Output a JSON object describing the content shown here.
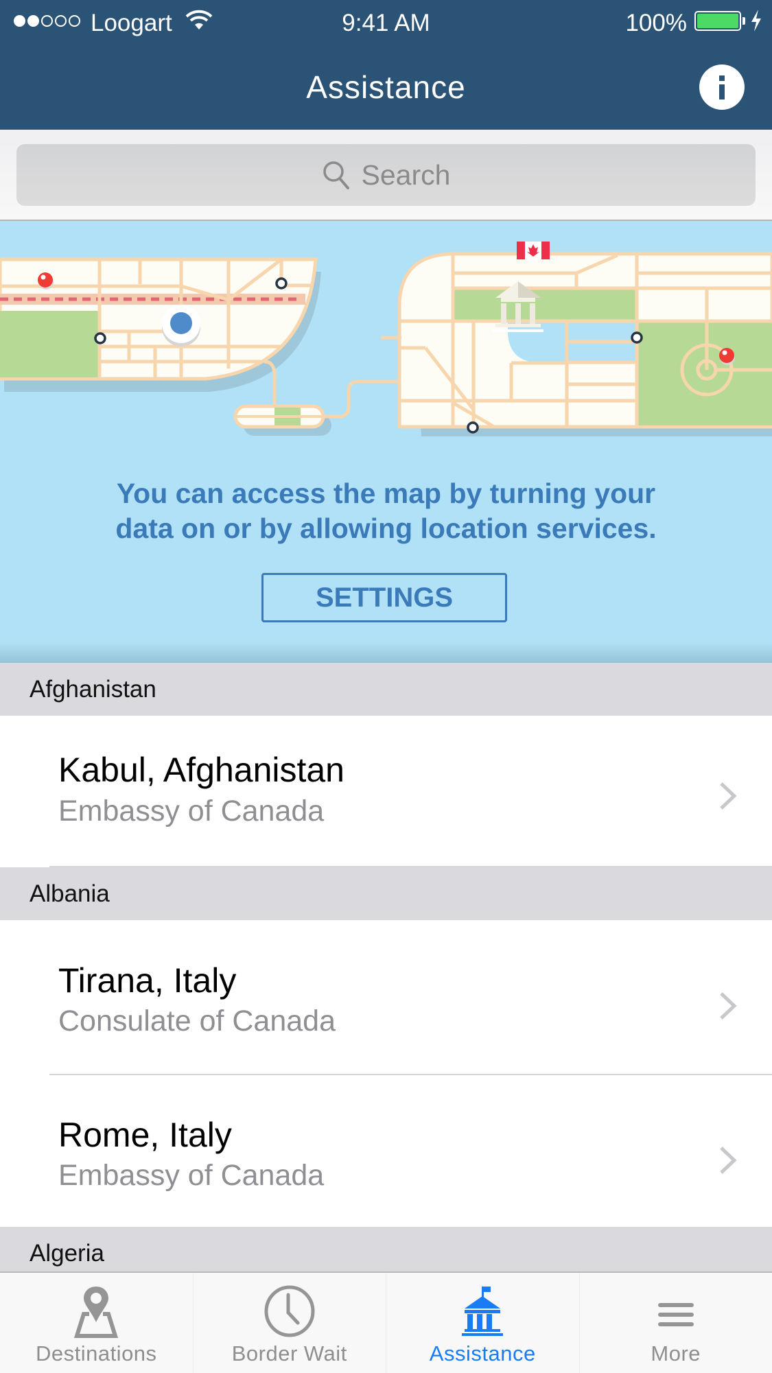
{
  "status_bar": {
    "signal_filled": 2,
    "signal_total": 5,
    "carrier": "Loogart",
    "time": "9:41 AM",
    "battery_percent": "100%",
    "battery_level": 1.0,
    "charging": true
  },
  "header": {
    "title": "Assistance",
    "info_icon": "info-icon"
  },
  "search": {
    "placeholder": "Search",
    "icon": "search-icon"
  },
  "map_banner": {
    "message": "You can access the map by turning your data on or by allowing  location services.",
    "message_line1": "You can access the map by turning your",
    "message_line2": "data on or by allowing  location services.",
    "button_label": "SETTINGS"
  },
  "sections": [
    {
      "title": "Afghanistan",
      "items": [
        {
          "city": "Kabul, Afghanistan",
          "office": "Embassy of Canada"
        }
      ]
    },
    {
      "title": "Albania",
      "items": [
        {
          "city": "Tirana, Italy",
          "office": "Consulate of Canada"
        },
        {
          "city": "Rome, Italy",
          "office": "Embassy of Canada"
        }
      ]
    },
    {
      "title": "Algeria",
      "items": []
    }
  ],
  "tab_bar": {
    "active_index": 2,
    "tabs": [
      {
        "label": "Destinations",
        "icon": "map-pin-icon"
      },
      {
        "label": "Border Wait",
        "icon": "clock-icon"
      },
      {
        "label": "Assistance",
        "icon": "embassy-icon"
      },
      {
        "label": "More",
        "icon": "menu-icon"
      }
    ]
  },
  "colors": {
    "nav_bg": "#2a5376",
    "accent": "#1a7cf4",
    "map_water": "#b1e1f6",
    "map_text": "#3a7ab8",
    "battery": "#4cd964"
  }
}
